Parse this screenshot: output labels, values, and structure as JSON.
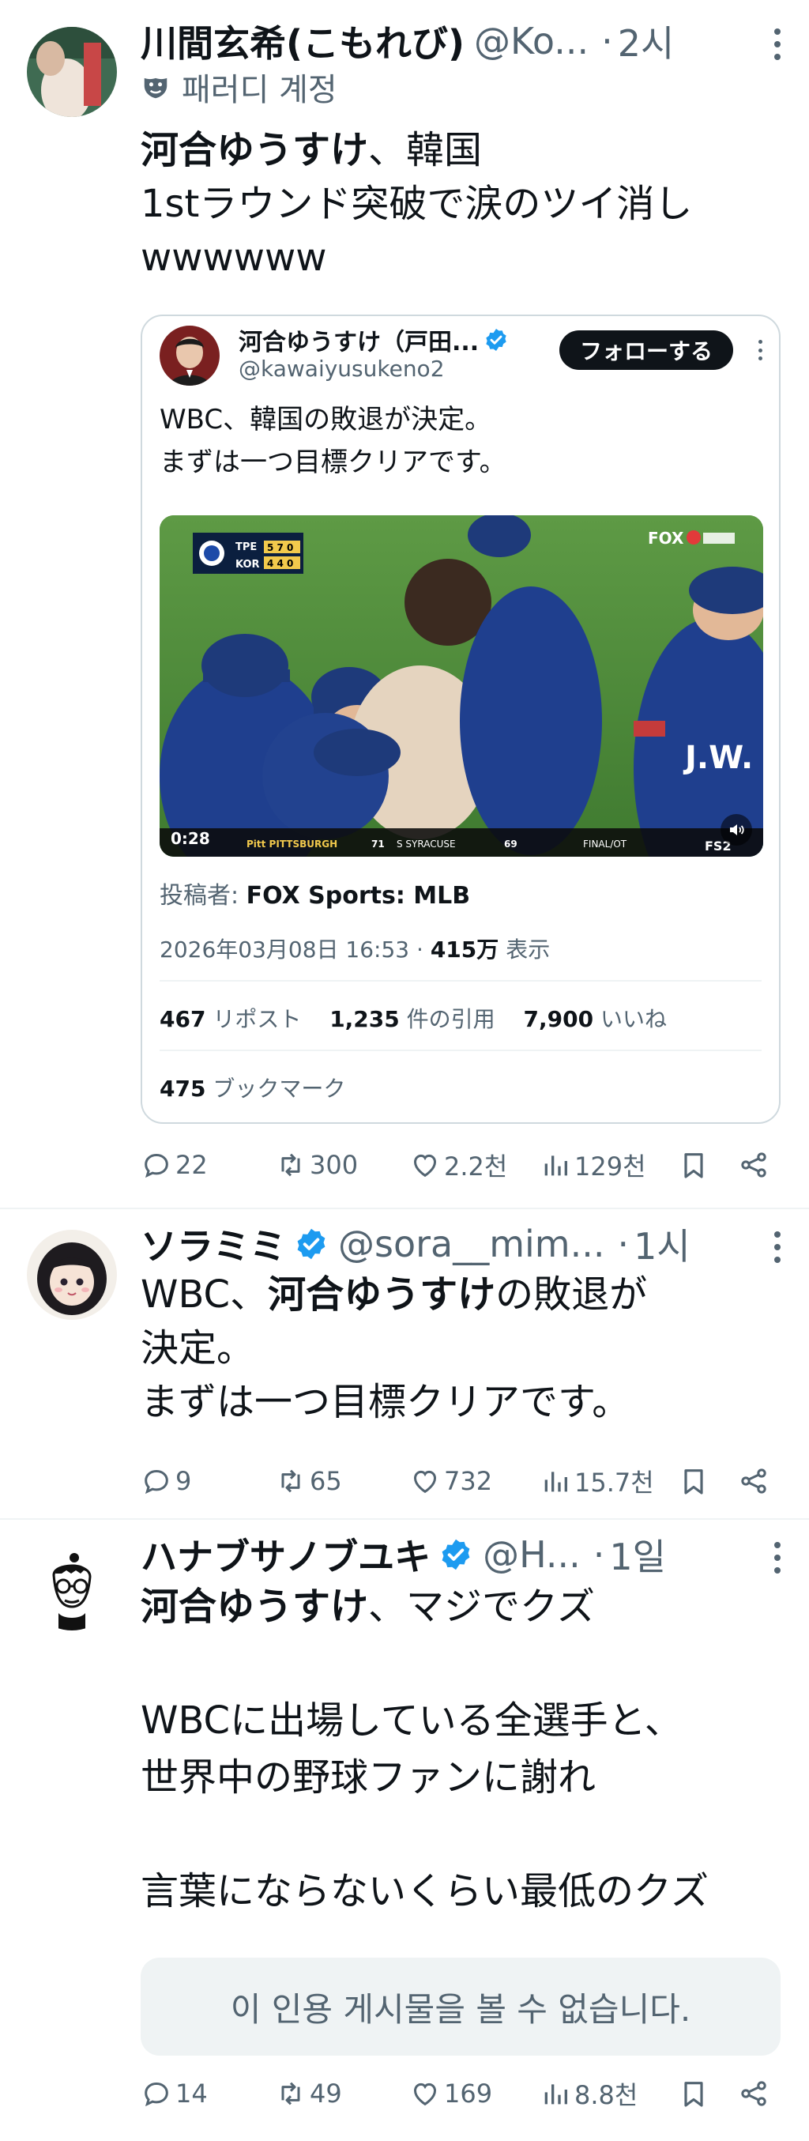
{
  "tweet1": {
    "display_name": "川間玄希(こもれび)",
    "handle": "@Ko...",
    "separator": "·",
    "time": "2시",
    "parody_label": "패러디 계정",
    "text_bold": "河合ゆうすけ",
    "text_rest": "、韓国\n1stラウンド突破で涙のツイ消し\nwwwwww",
    "quote": {
      "display_name": "河合ゆうすけ（戸田...",
      "handle": "@kawaiyusukeno2",
      "follow_label": "フォローする",
      "text": "WBC、韓国の敗退が決定。\nまずは一つ目標クリアです。",
      "video": {
        "duration": "0:28",
        "network": "FOX",
        "scoreboard_team1": "TPE",
        "scoreboard_team1_score": "5 7 0",
        "scoreboard_team2": "KOR",
        "scoreboard_team2_score": "4 4 0",
        "ticker_left": "Pitt PITTSBURGH",
        "ticker_left_score": "71",
        "ticker_mid": "S SYRACUSE",
        "ticker_mid_score": "69",
        "ticker_right": "FINAL/OT",
        "channel": "FS2",
        "jersey": "J.W."
      },
      "poster_label": "投稿者:",
      "poster_name": "FOX Sports: MLB",
      "datetime": "2026年03月08日 16:53 ·",
      "views_num": "415万",
      "views_label": "表示",
      "reposts_num": "467",
      "reposts_label": "リポスト",
      "quotes_num": "1,235",
      "quotes_label": "件の引用",
      "likes_num": "7,900",
      "likes_label": "いいね",
      "bookmarks_num": "475",
      "bookmarks_label": "ブックマーク"
    },
    "replies": "22",
    "retweets": "300",
    "likes": "2.2천",
    "views": "129천"
  },
  "tweet2": {
    "display_name": "ソラミミ",
    "handle": "@sora__mim...",
    "separator": "·",
    "time": "1시",
    "text_a": "WBC、",
    "text_bold": "河合ゆうすけ",
    "text_b": "の敗退が\n決定。\nまずは一つ目標クリアです。",
    "replies": "9",
    "retweets": "65",
    "likes": "732",
    "views": "15.7천"
  },
  "tweet3": {
    "display_name": "ハナブサノブユキ",
    "handle": "@H...",
    "separator": "·",
    "time": "1일",
    "text_bold": "河合ゆうすけ",
    "text_rest": "、マジでクズ\n\nWBCに出場している全選手と、\n世界中の野球ファンに謝れ\n\n言葉にならないくらい最低のクズ",
    "unavailable_label": "이 인용 게시물을 볼 수 없습니다.",
    "replies": "14",
    "retweets": "49",
    "likes": "169",
    "views": "8.8천"
  },
  "colors": {
    "text": "#0f1419",
    "secondary": "#536471",
    "verified": "#1d9bf0",
    "border": "#cfd9de"
  }
}
